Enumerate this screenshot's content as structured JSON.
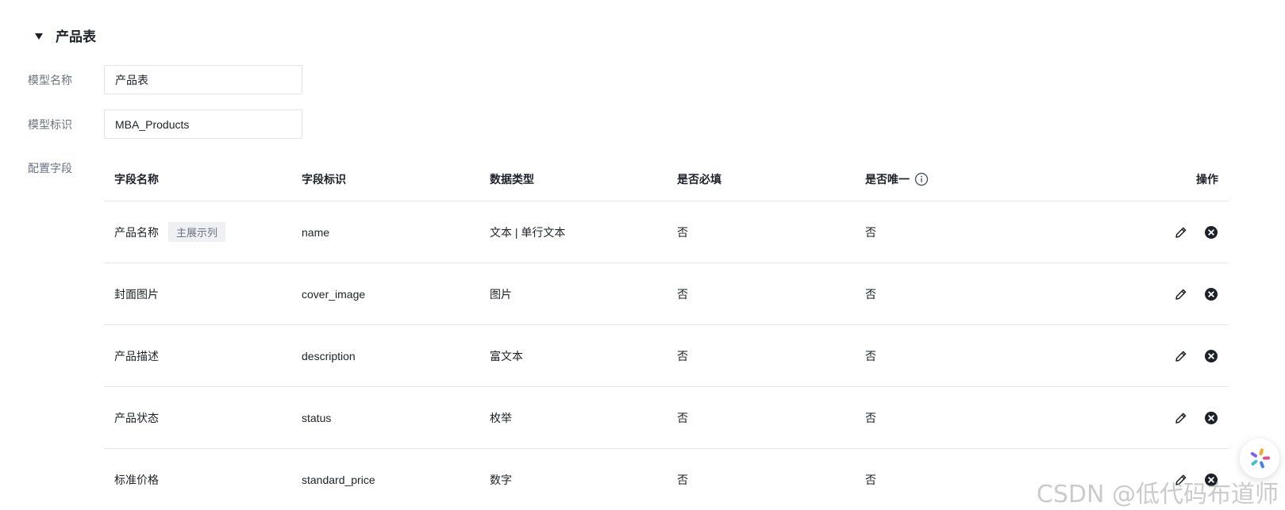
{
  "section": {
    "title": "产品表",
    "collapse_icon": "caret-down-icon"
  },
  "form": {
    "model_name_label": "模型名称",
    "model_name_value": "产品表",
    "model_id_label": "模型标识",
    "model_id_value": "MBA_Products",
    "fields_label": "配置字段"
  },
  "table": {
    "headers": {
      "field_name": "字段名称",
      "field_id": "字段标识",
      "data_type": "数据类型",
      "required": "是否必填",
      "unique": "是否唯一",
      "actions": "操作"
    },
    "rows": [
      {
        "name": "产品名称",
        "tag": "主展示列",
        "id": "name",
        "type": "文本 | 单行文本",
        "required": "否",
        "unique": "否"
      },
      {
        "name": "封面图片",
        "tag": "",
        "id": "cover_image",
        "type": "图片",
        "required": "否",
        "unique": "否"
      },
      {
        "name": "产品描述",
        "tag": "",
        "id": "description",
        "type": "富文本",
        "required": "否",
        "unique": "否"
      },
      {
        "name": "产品状态",
        "tag": "",
        "id": "status",
        "type": "枚举",
        "required": "否",
        "unique": "否"
      },
      {
        "name": "标准价格",
        "tag": "",
        "id": "standard_price",
        "type": "数字",
        "required": "否",
        "unique": "否"
      }
    ]
  },
  "icons": {
    "info": "info-icon",
    "edit": "edit-pencil-icon",
    "delete": "delete-circle-icon",
    "assistant": "assistant-logo-icon"
  },
  "watermark": "CSDN @低代码布道师",
  "colors": {
    "text": "#1d2129",
    "label": "#6b7280",
    "border": "#e5e6eb",
    "tag_bg": "#eef0f3"
  }
}
